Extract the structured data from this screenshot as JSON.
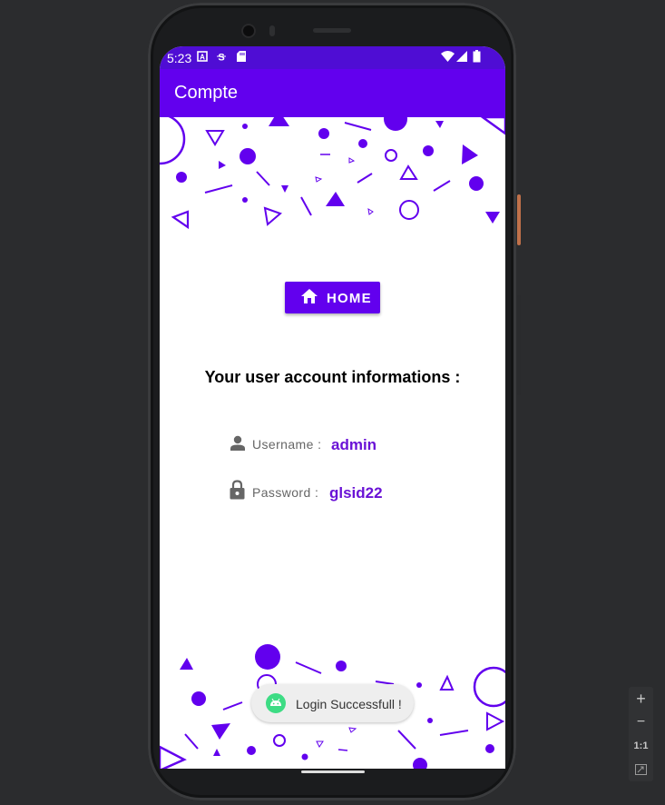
{
  "status_bar": {
    "time": "5:23",
    "left_icons": [
      "a-icon",
      "s-icon",
      "sd-card-icon"
    ],
    "right_icons": [
      "wifi-icon",
      "signal-icon",
      "battery-icon"
    ]
  },
  "app_bar": {
    "title": "Compte"
  },
  "home_button": {
    "label": "HOME",
    "icon": "home-icon"
  },
  "heading": "Your user account informations :",
  "account": {
    "username_label": "Username :",
    "username_value": "admin",
    "password_label": "Password :",
    "password_value": "glsid22"
  },
  "toast": {
    "message": "Login Successfull !",
    "icon": "android-icon"
  },
  "emulator_controls": {
    "zoom_in": "+",
    "zoom_out": "−",
    "actual_size": "1:1",
    "fit_icon": "fit-screen-icon"
  },
  "colors": {
    "primary": "#6200ee",
    "status_bar": "#4f0dd4",
    "value_text": "#6a12d6"
  }
}
